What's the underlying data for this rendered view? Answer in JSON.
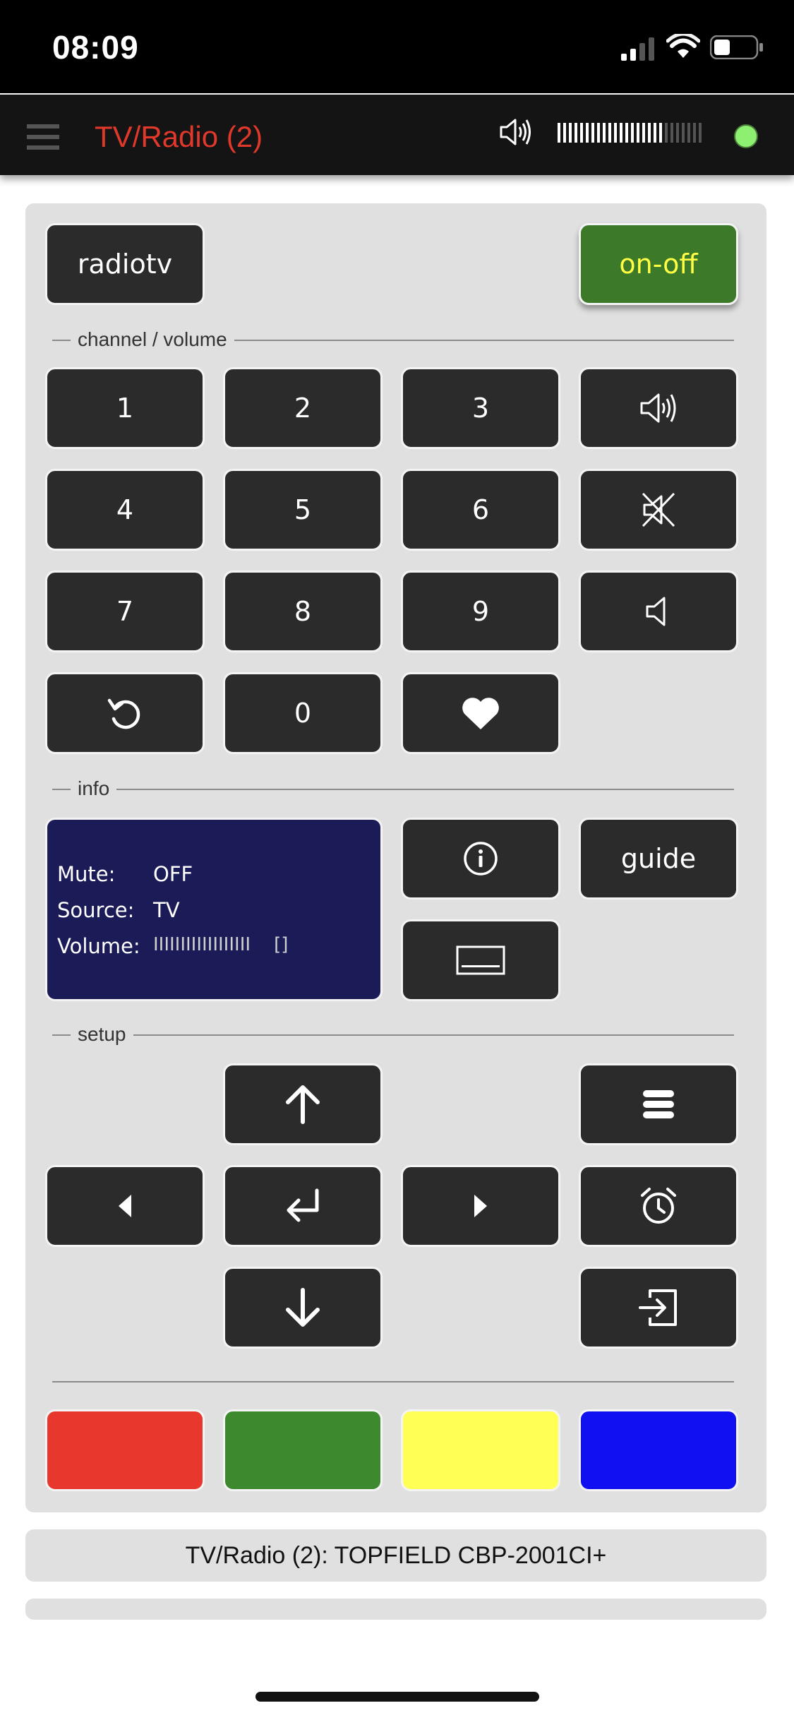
{
  "status_bar": {
    "time": "08:09"
  },
  "app_bar": {
    "title": "TV/Radio (2)",
    "volume_bar": {
      "level_fraction": 0.73
    },
    "status_color": "#8ef070"
  },
  "colors": {
    "accent_title": "#e0382a",
    "power_button": "#3c7a2a",
    "power_text": "#ffff44",
    "info_bg": "#1b1b58"
  },
  "top_row": {
    "radiotv_label": "radiotv",
    "on_off_label": "on-off"
  },
  "sections": {
    "channel_volume": "channel / volume",
    "info": "info",
    "setup": "setup"
  },
  "keypad": {
    "k1": "1",
    "k2": "2",
    "k3": "3",
    "k4": "4",
    "k5": "5",
    "k6": "6",
    "k7": "7",
    "k8": "8",
    "k9": "9",
    "k0": "0"
  },
  "info_panel": {
    "mute_label": "Mute:",
    "mute_value": "OFF",
    "source_label": "Source:",
    "source_value": "TV",
    "volume_label": "Volume:",
    "volume_value": "IIIIIIIIIIIIIIIIII    []"
  },
  "guide_label": "guide",
  "color_buttons": [
    {
      "name": "red",
      "color": "#e8372c"
    },
    {
      "name": "green",
      "color": "#3d8a2e"
    },
    {
      "name": "yellow",
      "color": "#ffff55"
    },
    {
      "name": "blue",
      "color": "#1010f0"
    }
  ],
  "footer": {
    "device": "TV/Radio (2): TOPFIELD CBP-2001CI+"
  },
  "icons": [
    "menu-icon",
    "volume-up-icon",
    "mute-icon",
    "volume-down-icon",
    "replay-icon",
    "heart-icon",
    "info-icon",
    "subtitle-icon",
    "arrow-up-icon",
    "menu-lines-icon",
    "arrow-left-icon",
    "enter-icon",
    "arrow-right-icon",
    "alarm-icon",
    "arrow-down-icon",
    "exit-icon"
  ]
}
